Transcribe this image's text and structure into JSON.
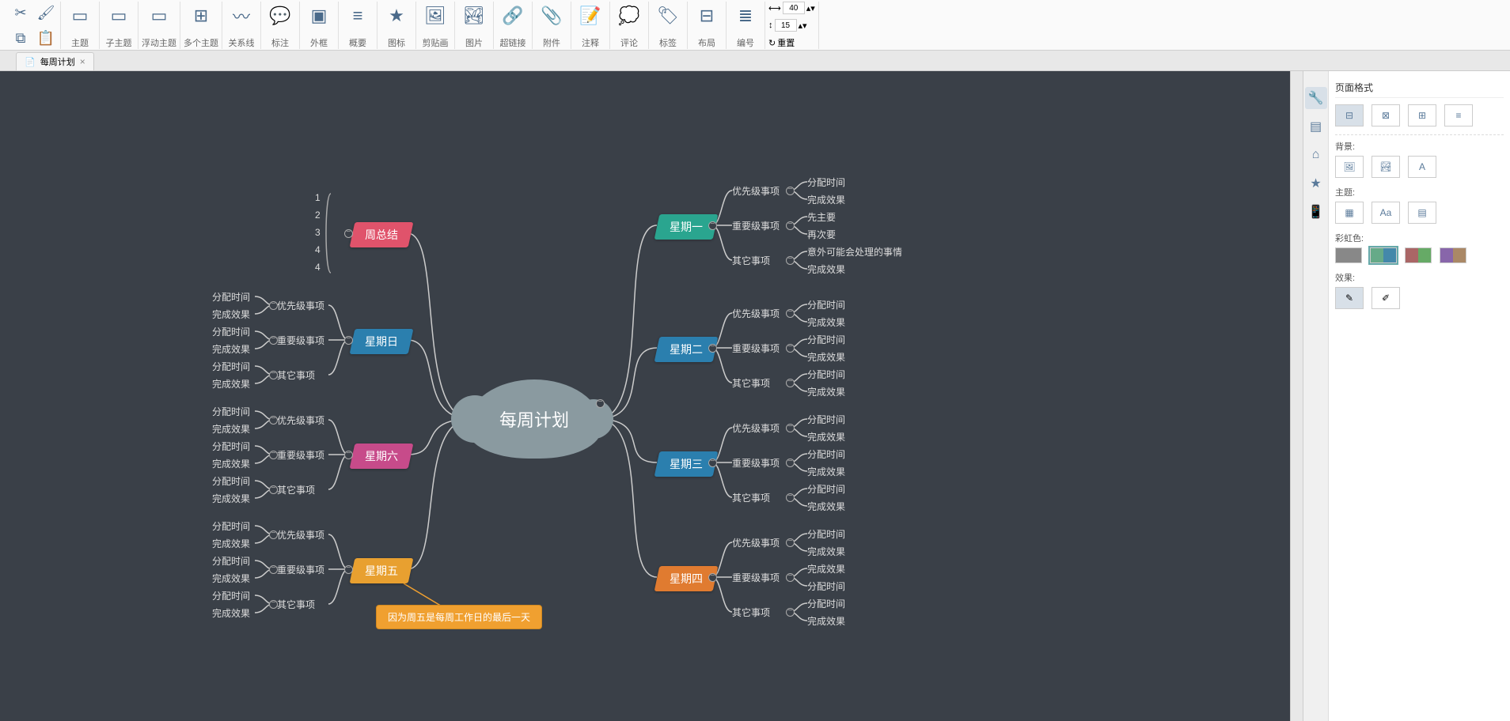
{
  "ribbon": {
    "clipboard": [
      "cut-icon",
      "format-painter-icon",
      "copy-icon",
      "paste-icon"
    ],
    "topics": [
      {
        "icon": "topic-icon",
        "label": "主题"
      },
      {
        "icon": "subtopic-icon",
        "label": "子主题"
      },
      {
        "icon": "floating-topic-icon",
        "label": "浮动主题"
      },
      {
        "icon": "multi-topic-icon",
        "label": "多个主题"
      }
    ],
    "insert": [
      {
        "icon": "relationship-icon",
        "label": "关系线"
      },
      {
        "icon": "callout-icon",
        "label": "标注"
      },
      {
        "icon": "boundary-icon",
        "label": "外框"
      },
      {
        "icon": "summary-icon",
        "label": "概要"
      }
    ],
    "media": [
      {
        "icon": "iconset-icon",
        "label": "图标"
      },
      {
        "icon": "clipart-icon",
        "label": "剪贴画"
      },
      {
        "icon": "image-icon",
        "label": "图片"
      }
    ],
    "attach": [
      {
        "icon": "hyperlink-icon",
        "label": "超链接"
      },
      {
        "icon": "attachment-icon",
        "label": "附件"
      },
      {
        "icon": "note-icon",
        "label": "注释"
      },
      {
        "icon": "comment-icon",
        "label": "评论"
      },
      {
        "icon": "tag-icon",
        "label": "标签"
      }
    ],
    "layout": [
      {
        "icon": "layout-icon",
        "label": "布局"
      },
      {
        "icon": "number-icon",
        "label": "编号"
      }
    ],
    "size": {
      "w": "40",
      "h": "15",
      "reset": "重置"
    }
  },
  "tab": {
    "title": "每周计划"
  },
  "panel": {
    "title": "页面格式",
    "bg_label": "背景:",
    "theme_label": "主题:",
    "rainbow_label": "彩虹色:",
    "effect_label": "效果:"
  },
  "map": {
    "center": "每周计划",
    "callout": "因为周五是每周工作日的最后一天",
    "summary_nums": [
      "1",
      "2",
      "3",
      "4",
      "4"
    ],
    "right": [
      {
        "label": "星期一",
        "color": "#2aa58f",
        "subs": [
          {
            "label": "优先级事项",
            "leaves": [
              "分配时间",
              "完成效果"
            ]
          },
          {
            "label": "重要级事项",
            "leaves": [
              "先主要",
              "再次要"
            ]
          },
          {
            "label": "其它事项",
            "leaves": [
              "意外可能会处理的事情",
              "完成效果"
            ]
          }
        ]
      },
      {
        "label": "星期二",
        "color": "#2b7fae",
        "subs": [
          {
            "label": "优先级事项",
            "leaves": [
              "分配时间",
              "完成效果"
            ]
          },
          {
            "label": "重要级事项",
            "leaves": [
              "分配时间",
              "完成效果"
            ]
          },
          {
            "label": "其它事项",
            "leaves": [
              "分配时间",
              "完成效果"
            ]
          }
        ]
      },
      {
        "label": "星期三",
        "color": "#2b7fae",
        "subs": [
          {
            "label": "优先级事项",
            "leaves": [
              "分配时间",
              "完成效果"
            ]
          },
          {
            "label": "重要级事项",
            "leaves": [
              "分配时间",
              "完成效果"
            ]
          },
          {
            "label": "其它事项",
            "leaves": [
              "分配时间",
              "完成效果"
            ]
          }
        ]
      },
      {
        "label": "星期四",
        "color": "#e07b30",
        "subs": [
          {
            "label": "优先级事项",
            "leaves": [
              "分配时间",
              "完成效果"
            ]
          },
          {
            "label": "重要级事项",
            "leaves": [
              "完成效果",
              "分配时间"
            ]
          },
          {
            "label": "其它事项",
            "leaves": [
              "分配时间",
              "完成效果"
            ]
          }
        ]
      }
    ],
    "left": [
      {
        "label": "周总结",
        "color": "#e0536b",
        "subs": [],
        "numbered": true
      },
      {
        "label": "星期日",
        "color": "#2b7fae",
        "subs": [
          {
            "label": "优先级事项",
            "leaves": [
              "分配时间",
              "完成效果"
            ]
          },
          {
            "label": "重要级事项",
            "leaves": [
              "分配时间",
              "完成效果"
            ]
          },
          {
            "label": "其它事项",
            "leaves": [
              "分配时间",
              "完成效果"
            ]
          }
        ]
      },
      {
        "label": "星期六",
        "color": "#c74b8a",
        "subs": [
          {
            "label": "优先级事项",
            "leaves": [
              "分配时间",
              "完成效果"
            ]
          },
          {
            "label": "重要级事项",
            "leaves": [
              "分配时间",
              "完成效果"
            ]
          },
          {
            "label": "其它事项",
            "leaves": [
              "分配时间",
              "完成效果"
            ]
          }
        ]
      },
      {
        "label": "星期五",
        "color": "#e8a030",
        "subs": [
          {
            "label": "优先级事项",
            "leaves": [
              "分配时间",
              "完成效果"
            ]
          },
          {
            "label": "重要级事项",
            "leaves": [
              "分配时间",
              "完成效果"
            ]
          },
          {
            "label": "其它事项",
            "leaves": [
              "分配时间",
              "完成效果"
            ]
          }
        ]
      }
    ]
  }
}
